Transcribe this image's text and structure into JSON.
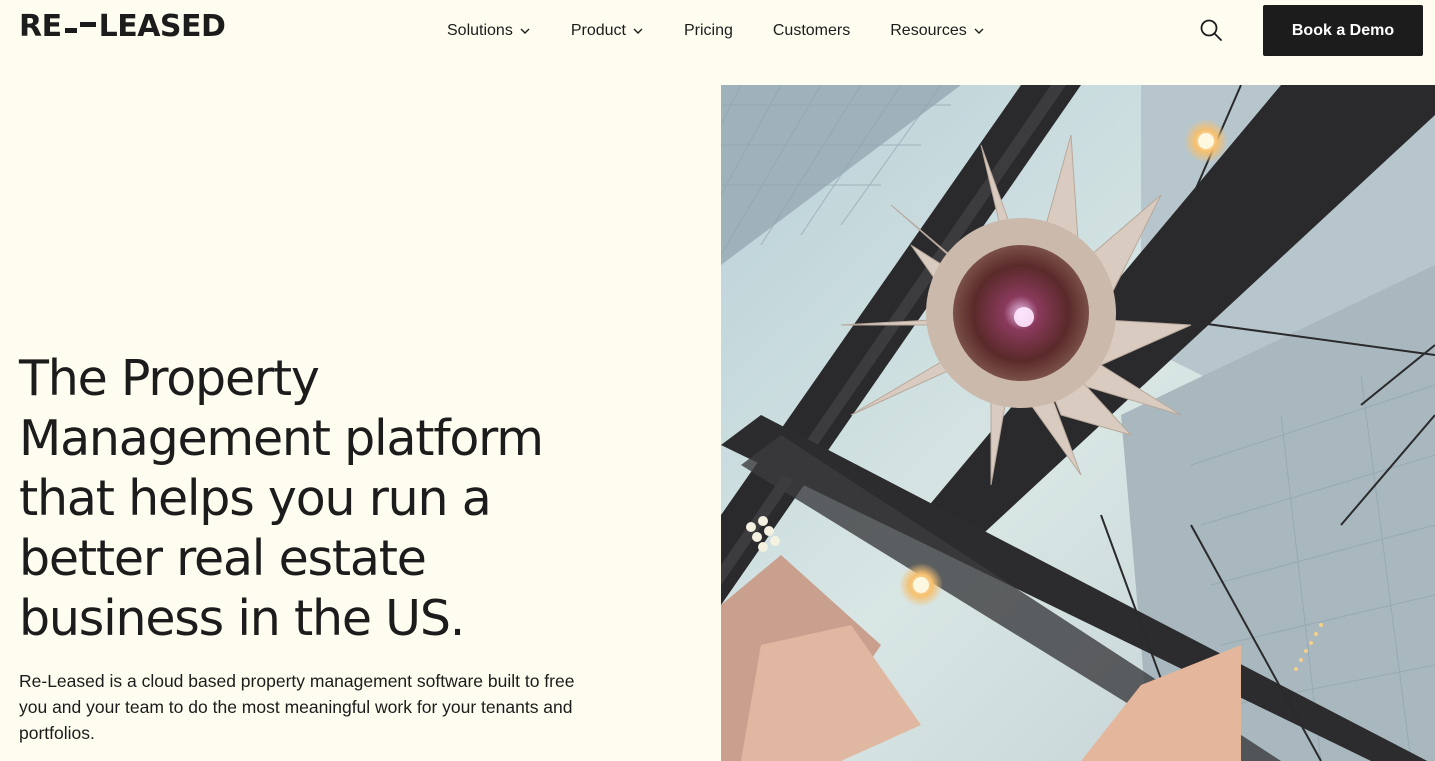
{
  "header": {
    "logo_left": "RE",
    "logo_right": "LEASED",
    "nav": [
      {
        "label": "Solutions",
        "has_dropdown": true
      },
      {
        "label": "Product",
        "has_dropdown": true
      },
      {
        "label": "Pricing",
        "has_dropdown": false
      },
      {
        "label": "Customers",
        "has_dropdown": false
      },
      {
        "label": "Resources",
        "has_dropdown": true
      }
    ],
    "search_icon": "search-icon",
    "cta_label": "Book a Demo"
  },
  "hero": {
    "title": "The Property Management platform that helps you run a better real estate business in the US.",
    "description": "Re-Leased is a cloud based property management software built to free you and your team to do the most meaningful work for your tenants and portfolios.",
    "media": "atrium-sculpture-video"
  },
  "colors": {
    "background": "#fffdf0",
    "text": "#1c1c1c",
    "button_bg": "#1c1c1c",
    "button_text": "#ffffff"
  }
}
